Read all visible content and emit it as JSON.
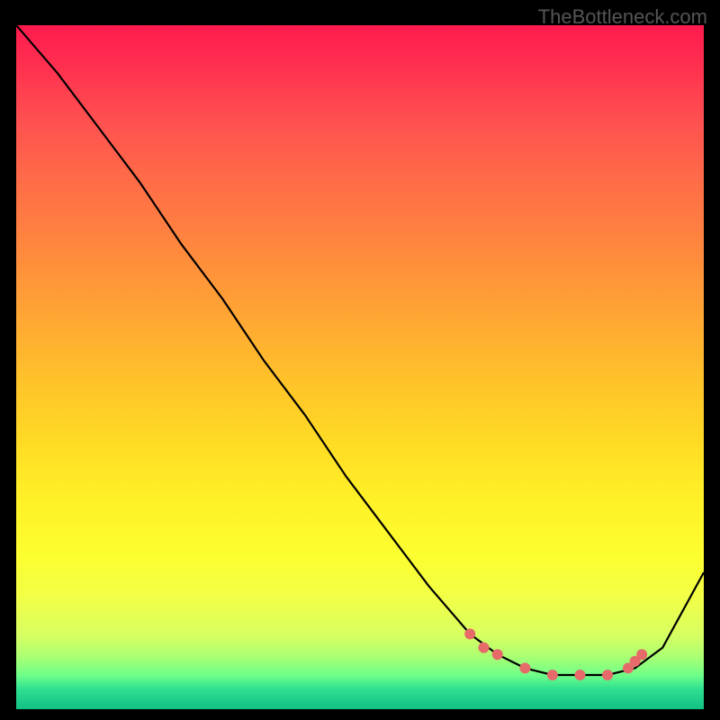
{
  "watermark": "TheBottleneck.com",
  "chart_data": {
    "type": "line",
    "title": "",
    "xlabel": "",
    "ylabel": "",
    "xlim": [
      0,
      100
    ],
    "ylim": [
      0,
      100
    ],
    "series": [
      {
        "name": "curve",
        "x": [
          0,
          6,
          12,
          18,
          24,
          30,
          36,
          42,
          48,
          54,
          60,
          66,
          70,
          74,
          78,
          82,
          86,
          90,
          94,
          100
        ],
        "y": [
          100,
          93,
          85,
          77,
          68,
          60,
          51,
          43,
          34,
          26,
          18,
          11,
          8,
          6,
          5,
          5,
          5,
          6,
          9,
          20
        ],
        "color": "#000000"
      }
    ],
    "markers": [
      {
        "x": 66,
        "y": 11
      },
      {
        "x": 68,
        "y": 9
      },
      {
        "x": 70,
        "y": 8
      },
      {
        "x": 74,
        "y": 6
      },
      {
        "x": 78,
        "y": 5
      },
      {
        "x": 82,
        "y": 5
      },
      {
        "x": 86,
        "y": 5
      },
      {
        "x": 89,
        "y": 6
      },
      {
        "x": 90,
        "y": 7
      },
      {
        "x": 91,
        "y": 8
      }
    ],
    "marker_style": {
      "color": "#e76a6a",
      "radius": 6
    },
    "gradient": {
      "top": "#ff1a4d",
      "mid": "#ffde24",
      "bottom": "#10c085"
    }
  }
}
